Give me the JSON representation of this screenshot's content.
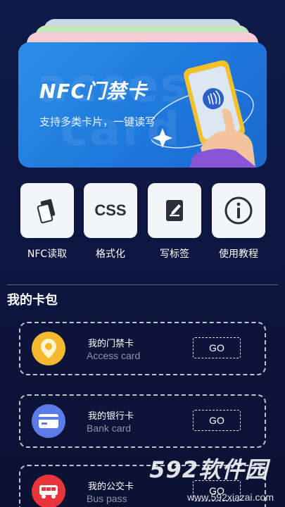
{
  "banner": {
    "title": "NFC门禁卡",
    "subtitle": "支持多类卡片，一键读写",
    "ghost_text_1": "access",
    "ghost_text_2": "card"
  },
  "tools": [
    {
      "label": "NFC读取",
      "icon": "card-read-icon"
    },
    {
      "label": "格式化",
      "icon": "css-icon",
      "icon_text": "CSS"
    },
    {
      "label": "写标签",
      "icon": "write-tag-icon"
    },
    {
      "label": "使用教程",
      "icon": "info-icon"
    }
  ],
  "section": {
    "title": "我的卡包"
  },
  "cards": [
    {
      "name": "我的门禁卡",
      "en": "Access card",
      "action": "GO",
      "icon": "location-pin-icon",
      "color": "#f5b82e"
    },
    {
      "name": "我的银行卡",
      "en": "Bank card",
      "action": "GO",
      "icon": "bank-card-icon",
      "color": "#5b7ce8"
    },
    {
      "name": "我的公交卡",
      "en": "Bus pass",
      "action": "GO",
      "icon": "bus-icon",
      "color": "#e8343a"
    }
  ],
  "watermark": {
    "brand": "592软件园",
    "url": "www.592xiazai.com"
  }
}
